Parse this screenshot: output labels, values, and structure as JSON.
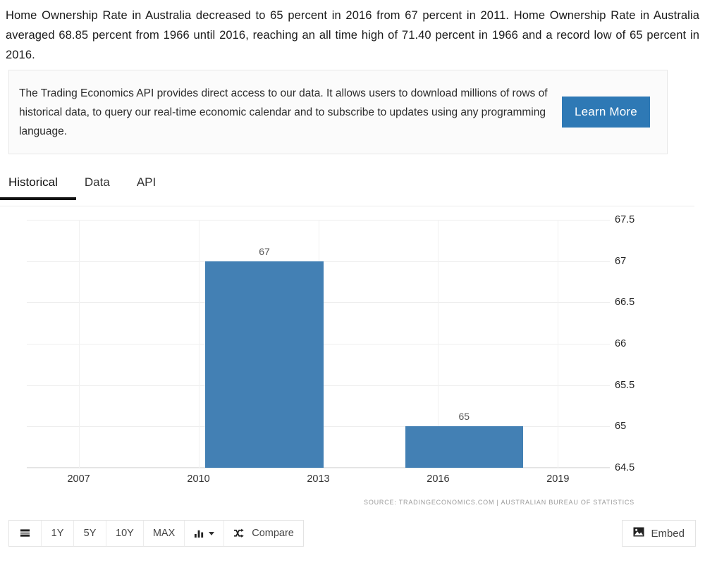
{
  "intro": {
    "paragraph": "Home Ownership Rate in Australia decreased to 65 percent in 2016 from 67 percent in 2011. Home Ownership Rate in Australia averaged 68.85 percent from 1966 until 2016, reaching an all time high of 71.40 percent in 1966 and a record low of 65 percent in 2016."
  },
  "api_banner": {
    "text": "The Trading Economics API provides direct access to our data. It allows users to download millions of rows of historical data, to query our real-time economic calendar and to subscribe to updates using any programming language.",
    "button_label": "Learn More",
    "button_color": "#2e79b5"
  },
  "tabs": [
    {
      "label": "Historical",
      "active": true
    },
    {
      "label": "Data",
      "active": false
    },
    {
      "label": "API",
      "active": false
    }
  ],
  "chart_data": {
    "type": "bar",
    "title": "",
    "xlabel": "",
    "ylabel": "",
    "categories": [
      "2011",
      "2016"
    ],
    "values": [
      67,
      65
    ],
    "data_labels": [
      "67",
      "65"
    ],
    "ylim": [
      64.5,
      67.5
    ],
    "yticks": [
      "67.5",
      "67",
      "66.5",
      "66",
      "65.5",
      "65",
      "64.5"
    ],
    "ytick_values": [
      67.5,
      67,
      66.5,
      66,
      65.5,
      65,
      64.5
    ],
    "xticks": [
      "2007",
      "2010",
      "2013",
      "2016",
      "2019"
    ],
    "xtick_values": [
      2007,
      2010,
      2013,
      2016,
      2019
    ],
    "xlim": [
      2005.7,
      2020.3
    ],
    "grid": true,
    "legend": "none",
    "bar_color": "#4380b4",
    "source": "SOURCE: TRADINGECONOMICS.COM  |  AUSTRALIAN BUREAU OF STATISTICS"
  },
  "toolbar": {
    "buttons": [
      {
        "name": "list-view",
        "label": "",
        "icon": "list-icon"
      },
      {
        "name": "range-1y",
        "label": "1Y",
        "icon": ""
      },
      {
        "name": "range-5y",
        "label": "5Y",
        "icon": ""
      },
      {
        "name": "range-10y",
        "label": "10Y",
        "icon": ""
      },
      {
        "name": "range-max",
        "label": "MAX",
        "icon": ""
      },
      {
        "name": "chart-type",
        "label": "",
        "icon": "bar-chart-icon"
      },
      {
        "name": "compare",
        "label": "Compare",
        "icon": "shuffle-icon"
      }
    ],
    "embed_label": "Embed"
  }
}
